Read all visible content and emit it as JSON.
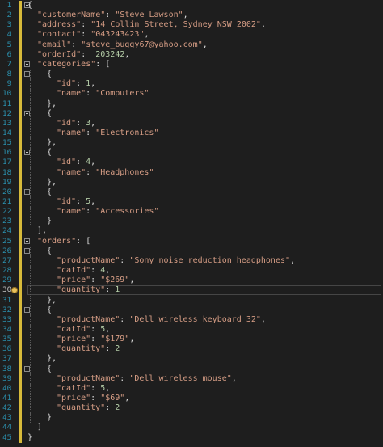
{
  "editor": {
    "colors": {
      "background": "#1e1e1e",
      "line_number": "#2b91af",
      "string": "#d69d85",
      "number": "#b5cea8",
      "punctuation": "#dcdcdc",
      "change_bar": "#d7ba3a"
    },
    "active_line": 30,
    "lightbulb_icon": "lightbulb-icon",
    "lines": [
      {
        "no": "1",
        "indent": 0,
        "tokens": [
          [
            "p",
            "{"
          ]
        ]
      },
      {
        "no": "2",
        "indent": 1,
        "tokens": [
          [
            "k",
            "\"customerName\""
          ],
          [
            "p",
            ": "
          ],
          [
            "s",
            "\"Steve Lawson\""
          ],
          [
            "p",
            ","
          ]
        ]
      },
      {
        "no": "3",
        "indent": 1,
        "tokens": [
          [
            "k",
            "\"address\""
          ],
          [
            "p",
            ": "
          ],
          [
            "s",
            "\"14 Collin Street, Sydney NSW 2002\""
          ],
          [
            "p",
            ","
          ]
        ]
      },
      {
        "no": "4",
        "indent": 1,
        "tokens": [
          [
            "k",
            "\"contact\""
          ],
          [
            "p",
            ": "
          ],
          [
            "s",
            "\"043243423\""
          ],
          [
            "p",
            ","
          ]
        ]
      },
      {
        "no": "5",
        "indent": 1,
        "tokens": [
          [
            "k",
            "\"email\""
          ],
          [
            "p",
            ": "
          ],
          [
            "s",
            "\"steve_buggy67@yahoo.com\""
          ],
          [
            "p",
            ","
          ]
        ]
      },
      {
        "no": "6",
        "indent": 1,
        "tokens": [
          [
            "k",
            "\"orderId\""
          ],
          [
            "p",
            ":  "
          ],
          [
            "n",
            "203242"
          ],
          [
            "p",
            ","
          ]
        ]
      },
      {
        "no": "7",
        "indent": 1,
        "tokens": [
          [
            "k",
            "\"categories\""
          ],
          [
            "p",
            ": ["
          ]
        ]
      },
      {
        "no": "8",
        "indent": 2,
        "tokens": [
          [
            "p",
            "{"
          ]
        ]
      },
      {
        "no": "9",
        "indent": 3,
        "tokens": [
          [
            "k",
            "\"id\""
          ],
          [
            "p",
            ": "
          ],
          [
            "n",
            "1"
          ],
          [
            "p",
            ","
          ]
        ]
      },
      {
        "no": "10",
        "indent": 3,
        "tokens": [
          [
            "k",
            "\"name\""
          ],
          [
            "p",
            ": "
          ],
          [
            "s",
            "\"Computers\""
          ]
        ]
      },
      {
        "no": "11",
        "indent": 2,
        "tokens": [
          [
            "p",
            "},"
          ]
        ]
      },
      {
        "no": "12",
        "indent": 2,
        "tokens": [
          [
            "p",
            "{"
          ]
        ]
      },
      {
        "no": "13",
        "indent": 3,
        "tokens": [
          [
            "k",
            "\"id\""
          ],
          [
            "p",
            ": "
          ],
          [
            "n",
            "3"
          ],
          [
            "p",
            ","
          ]
        ]
      },
      {
        "no": "14",
        "indent": 3,
        "tokens": [
          [
            "k",
            "\"name\""
          ],
          [
            "p",
            ": "
          ],
          [
            "s",
            "\"Electronics\""
          ]
        ]
      },
      {
        "no": "15",
        "indent": 2,
        "tokens": [
          [
            "p",
            "},"
          ]
        ]
      },
      {
        "no": "16",
        "indent": 2,
        "tokens": [
          [
            "p",
            "{"
          ]
        ]
      },
      {
        "no": "17",
        "indent": 3,
        "tokens": [
          [
            "k",
            "\"id\""
          ],
          [
            "p",
            ": "
          ],
          [
            "n",
            "4"
          ],
          [
            "p",
            ","
          ]
        ]
      },
      {
        "no": "18",
        "indent": 3,
        "tokens": [
          [
            "k",
            "\"name\""
          ],
          [
            "p",
            ": "
          ],
          [
            "s",
            "\"Headphones\""
          ]
        ]
      },
      {
        "no": "19",
        "indent": 2,
        "tokens": [
          [
            "p",
            "},"
          ]
        ]
      },
      {
        "no": "20",
        "indent": 2,
        "tokens": [
          [
            "p",
            "{"
          ]
        ]
      },
      {
        "no": "21",
        "indent": 3,
        "tokens": [
          [
            "k",
            "\"id\""
          ],
          [
            "p",
            ": "
          ],
          [
            "n",
            "5"
          ],
          [
            "p",
            ","
          ]
        ]
      },
      {
        "no": "22",
        "indent": 3,
        "tokens": [
          [
            "k",
            "\"name\""
          ],
          [
            "p",
            ": "
          ],
          [
            "s",
            "\"Accessories\""
          ]
        ]
      },
      {
        "no": "23",
        "indent": 2,
        "tokens": [
          [
            "p",
            "}"
          ]
        ]
      },
      {
        "no": "24",
        "indent": 1,
        "tokens": [
          [
            "p",
            "],"
          ]
        ]
      },
      {
        "no": "25",
        "indent": 1,
        "tokens": [
          [
            "k",
            "\"orders\""
          ],
          [
            "p",
            ": ["
          ]
        ]
      },
      {
        "no": "26",
        "indent": 2,
        "tokens": [
          [
            "p",
            "{"
          ]
        ]
      },
      {
        "no": "27",
        "indent": 3,
        "tokens": [
          [
            "k",
            "\"productName\""
          ],
          [
            "p",
            ": "
          ],
          [
            "s",
            "\"Sony noise reduction headphones\""
          ],
          [
            "p",
            ","
          ]
        ]
      },
      {
        "no": "28",
        "indent": 3,
        "tokens": [
          [
            "k",
            "\"catId\""
          ],
          [
            "p",
            ": "
          ],
          [
            "n",
            "4"
          ],
          [
            "p",
            ","
          ]
        ]
      },
      {
        "no": "29",
        "indent": 3,
        "tokens": [
          [
            "k",
            "\"price\""
          ],
          [
            "p",
            ": "
          ],
          [
            "s",
            "\"$269\""
          ],
          [
            "p",
            ","
          ]
        ]
      },
      {
        "no": "30",
        "indent": 3,
        "tokens": [
          [
            "k",
            "\"quantity\""
          ],
          [
            "p",
            ": "
          ],
          [
            "n",
            "1"
          ]
        ]
      },
      {
        "no": "31",
        "indent": 2,
        "tokens": [
          [
            "p",
            "},"
          ]
        ]
      },
      {
        "no": "32",
        "indent": 2,
        "tokens": [
          [
            "p",
            "{"
          ]
        ]
      },
      {
        "no": "33",
        "indent": 3,
        "tokens": [
          [
            "k",
            "\"productName\""
          ],
          [
            "p",
            ": "
          ],
          [
            "s",
            "\"Dell wireless keyboard 32\""
          ],
          [
            "p",
            ","
          ]
        ]
      },
      {
        "no": "34",
        "indent": 3,
        "tokens": [
          [
            "k",
            "\"catId\""
          ],
          [
            "p",
            ": "
          ],
          [
            "n",
            "5"
          ],
          [
            "p",
            ","
          ]
        ]
      },
      {
        "no": "35",
        "indent": 3,
        "tokens": [
          [
            "k",
            "\"price\""
          ],
          [
            "p",
            ": "
          ],
          [
            "s",
            "\"$179\""
          ],
          [
            "p",
            ","
          ]
        ]
      },
      {
        "no": "36",
        "indent": 3,
        "tokens": [
          [
            "k",
            "\"quantity\""
          ],
          [
            "p",
            ": "
          ],
          [
            "n",
            "2"
          ]
        ]
      },
      {
        "no": "37",
        "indent": 2,
        "tokens": [
          [
            "p",
            "},"
          ]
        ]
      },
      {
        "no": "38",
        "indent": 2,
        "tokens": [
          [
            "p",
            "{"
          ]
        ]
      },
      {
        "no": "39",
        "indent": 3,
        "tokens": [
          [
            "k",
            "\"productName\""
          ],
          [
            "p",
            ": "
          ],
          [
            "s",
            "\"Dell wireless mouse\""
          ],
          [
            "p",
            ","
          ]
        ]
      },
      {
        "no": "40",
        "indent": 3,
        "tokens": [
          [
            "k",
            "\"catId\""
          ],
          [
            "p",
            ": "
          ],
          [
            "n",
            "5"
          ],
          [
            "p",
            ","
          ]
        ]
      },
      {
        "no": "41",
        "indent": 3,
        "tokens": [
          [
            "k",
            "\"price\""
          ],
          [
            "p",
            ": "
          ],
          [
            "s",
            "\"$69\""
          ],
          [
            "p",
            ","
          ]
        ]
      },
      {
        "no": "42",
        "indent": 3,
        "tokens": [
          [
            "k",
            "\"quantity\""
          ],
          [
            "p",
            ": "
          ],
          [
            "n",
            "2"
          ]
        ]
      },
      {
        "no": "43",
        "indent": 2,
        "tokens": [
          [
            "p",
            "}"
          ]
        ]
      },
      {
        "no": "44",
        "indent": 1,
        "tokens": [
          [
            "p",
            "]"
          ]
        ]
      },
      {
        "no": "45",
        "indent": 0,
        "tokens": [
          [
            "p",
            "}"
          ]
        ]
      }
    ],
    "fold_lines": [
      "1",
      "7",
      "8",
      "12",
      "16",
      "20",
      "25",
      "26",
      "32",
      "38"
    ]
  }
}
